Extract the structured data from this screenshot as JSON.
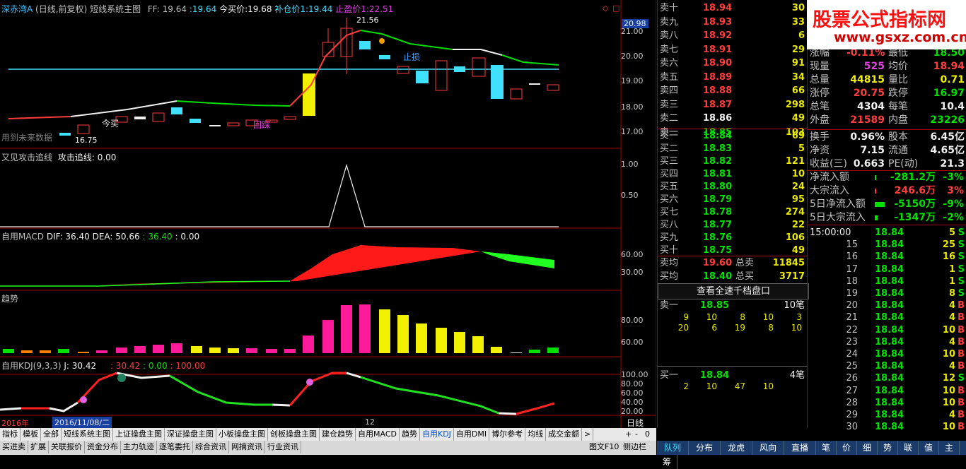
{
  "header": {
    "stock": "深赤湾A",
    "mode": "(日线,前复权)",
    "indicator": "短线系统主图",
    "ff_label": "FF:",
    "ff_value": "19.64",
    "ff_value2": ":19.64",
    "buy_price": "今买价:19.68",
    "add_price": "补仓价1:19.44",
    "take_profit": "止盈价1:22.51",
    "top_price_tag": "20.98"
  },
  "main_chart": {
    "labels": {
      "stop_loss": "止损",
      "buy": "今买",
      "track": "回踩",
      "future_warning": "用到未来数据",
      "high": "21.56",
      "low": "16.75"
    },
    "y_ticks": [
      "21.00",
      "20.00",
      "19.00",
      "18.00",
      "17.00"
    ]
  },
  "attack_panel": {
    "title": "又见攻击追线",
    "line_label": "攻击追线: 0.00",
    "y_ticks": [
      "1.00",
      "0.50"
    ]
  },
  "macd_panel": {
    "title": "自用MACD",
    "dif": "DIF: 36.40",
    "dea": "DEA: 50.66",
    "v1": ": 36.40",
    "v2": ": 0.00",
    "y_ticks": [
      "60.00",
      "30.00"
    ]
  },
  "trend_panel": {
    "title": "趋势",
    "y_ticks": [
      "80.00",
      "60.00"
    ]
  },
  "kdj_panel": {
    "title": "自用KDJ(9,3,3)",
    "j": "J: 30.42",
    "v1": ": 30.42",
    "v2": ": 0.00",
    "v3": ": 100.00",
    "y_ticks": [
      "100.00",
      "80.00",
      "60.00",
      "40.00",
      "20.00"
    ]
  },
  "date_bar": {
    "year": "2016年",
    "cursor_date": "2016/11/08/二",
    "month": "12"
  },
  "tabs": [
    "指标",
    "模板",
    "全部",
    "短线系统主图",
    "上证操盘主图",
    "深证操盘主图",
    "小板操盘主图",
    "创板操盘主图",
    "建仓趋势",
    "自用MACD",
    "趋势",
    "自用KDJ",
    "自用DMI",
    "博尔参考",
    "均线",
    "成交金额"
  ],
  "tab_controls": {
    "plus": "+",
    "minus": "-",
    "zero": "0",
    "period": "日线",
    "nav": ">"
  },
  "tabs2": [
    "买进卖",
    "扩展",
    "关联报价",
    "资金分布",
    "主力轨迹",
    "逐笔委托",
    "综合资讯",
    "网摘资讯",
    "行业资讯"
  ],
  "bottom_left_extra": [
    "图文F10",
    "侧边栏"
  ],
  "order_book": {
    "asks": [
      {
        "label": "卖十",
        "price": "18.94",
        "vol": "30"
      },
      {
        "label": "卖九",
        "price": "18.93",
        "vol": "33"
      },
      {
        "label": "卖八",
        "price": "18.92",
        "vol": "6"
      },
      {
        "label": "卖七",
        "price": "18.91",
        "vol": "29"
      },
      {
        "label": "卖六",
        "price": "18.90",
        "vol": "91"
      },
      {
        "label": "卖五",
        "price": "18.89",
        "vol": "34"
      },
      {
        "label": "卖四",
        "price": "18.88",
        "vol": "66"
      },
      {
        "label": "卖三",
        "price": "18.87",
        "vol": "298"
      },
      {
        "label": "卖二",
        "price": "18.86",
        "vol": "49"
      },
      {
        "label": "卖一",
        "price": "18.85",
        "vol": "103"
      }
    ],
    "bids": [
      {
        "label": "买一",
        "price": "18.84",
        "vol": "69"
      },
      {
        "label": "买二",
        "price": "18.83",
        "vol": "5"
      },
      {
        "label": "买三",
        "price": "18.82",
        "vol": "121"
      },
      {
        "label": "买四",
        "price": "18.81",
        "vol": "10"
      },
      {
        "label": "买五",
        "price": "18.80",
        "vol": "24"
      },
      {
        "label": "买六",
        "price": "18.79",
        "vol": "95"
      },
      {
        "label": "买七",
        "price": "18.78",
        "vol": "274"
      },
      {
        "label": "买八",
        "price": "18.77",
        "vol": "22"
      },
      {
        "label": "买九",
        "price": "18.76",
        "vol": "106"
      },
      {
        "label": "买十",
        "price": "18.75",
        "vol": "49"
      }
    ],
    "ask_avg": {
      "label": "卖均",
      "price": "19.60",
      "k": "总卖",
      "v": "11845"
    },
    "bid_avg": {
      "label": "买均",
      "price": "18.40",
      "k": "总买",
      "v": "3717"
    },
    "view_full": "查看全速千档盘口",
    "ask1_queue": {
      "label": "卖一",
      "price": "18.85",
      "count": "10笔",
      "row1": [
        "9",
        "10",
        "8",
        "10",
        "3"
      ],
      "row2": [
        "20",
        "6",
        "19",
        "8",
        "10"
      ]
    },
    "bid1_queue": {
      "label": "买一",
      "price": "18.84",
      "count": "4笔",
      "row1": [
        "2",
        "10",
        "47",
        "10"
      ]
    }
  },
  "brand": {
    "title": "股票公式指标网",
    "url": "www.gsxz.com.cn"
  },
  "stats": [
    {
      "k1": "涨幅",
      "v1": "-0.11%",
      "k2": "最低",
      "v2": "18.50"
    },
    {
      "k1": "现量",
      "v1": "525",
      "k2": "均价",
      "v2": "18.94"
    },
    {
      "k1": "总量",
      "v1": "44815",
      "k2": "量比",
      "v2": "0.71"
    },
    {
      "k1": "涨停",
      "v1": "20.75",
      "k2": "跌停",
      "v2": "16.97"
    },
    {
      "k1": "总笔",
      "v1": "4304",
      "k2": "每笔",
      "v2": "10.4"
    },
    {
      "k1": "外盘",
      "v1": "21589",
      "k2": "内盘",
      "v2": "23226"
    },
    {
      "k1": "换手",
      "v1": "0.96%",
      "k2": "股本",
      "v2": "6.45亿"
    },
    {
      "k1": "净资",
      "v1": "7.15",
      "k2": "流通",
      "v2": "4.65亿"
    },
    {
      "k1": "收益(三)",
      "v1": "0.663",
      "k2": "PE(动)",
      "v2": "21.3"
    }
  ],
  "flows": [
    {
      "k": "净流入额",
      "v": "-281.2万",
      "p": "-3%"
    },
    {
      "k": "大宗流入",
      "v": "246.6万",
      "p": "3%"
    },
    {
      "k": "5日净流入额",
      "v": "-5150万",
      "p": "-9%"
    },
    {
      "k": "5日大宗流入",
      "v": "-1347万",
      "p": "-2%"
    }
  ],
  "ticks": [
    {
      "t": "15:00:00",
      "p": "18.84",
      "q": "5",
      "s": "S"
    },
    {
      "t": "15",
      "p": "18.84",
      "q": "25",
      "s": "S"
    },
    {
      "t": "16",
      "p": "18.84",
      "q": "16",
      "s": "S"
    },
    {
      "t": "17",
      "p": "18.84",
      "q": "1",
      "s": "S"
    },
    {
      "t": "18",
      "p": "18.84",
      "q": "1",
      "s": "S"
    },
    {
      "t": "19",
      "p": "18.84",
      "q": "8",
      "s": "S"
    },
    {
      "t": "20",
      "p": "18.84",
      "q": "4",
      "s": "B"
    },
    {
      "t": "21",
      "p": "18.84",
      "q": "4",
      "s": "B"
    },
    {
      "t": "22",
      "p": "18.84",
      "q": "10",
      "s": "B"
    },
    {
      "t": "23",
      "p": "18.84",
      "q": "4",
      "s": "B"
    },
    {
      "t": "24",
      "p": "18.84",
      "q": "10",
      "s": "B"
    },
    {
      "t": "25",
      "p": "18.84",
      "q": "4",
      "s": "B"
    },
    {
      "t": "26",
      "p": "18.84",
      "q": "12",
      "s": "S"
    },
    {
      "t": "27",
      "p": "18.84",
      "q": "10",
      "s": "B"
    },
    {
      "t": "28",
      "p": "18.84",
      "q": "10",
      "s": "B"
    },
    {
      "t": "29",
      "p": "18.84",
      "q": "4",
      "s": "B"
    },
    {
      "t": "30",
      "p": "18.84",
      "q": "10",
      "s": "B"
    }
  ],
  "bottom_right": [
    "队列",
    "分布",
    "龙虎",
    "风向",
    "直播",
    "笔",
    "价",
    "细",
    "势",
    "联",
    "值",
    "主",
    "筹"
  ],
  "colors": {
    "up": "#ff3c3c",
    "down": "#00e000",
    "flat": "#f0f0f0",
    "yellow": "#f0f000",
    "cyan": "#40e0ff"
  }
}
